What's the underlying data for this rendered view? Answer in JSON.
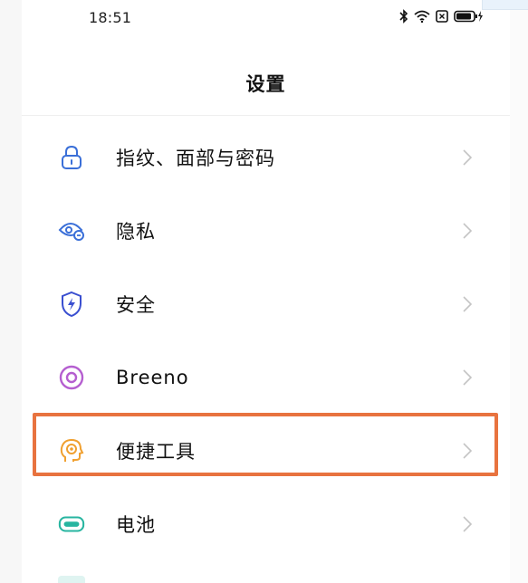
{
  "status_bar": {
    "time": "18:51",
    "icons": [
      "bluetooth-icon",
      "wifi-icon",
      "sim-off-icon",
      "battery-charging-icon"
    ]
  },
  "header": {
    "title": "设置"
  },
  "settings": {
    "items": [
      {
        "label": "指纹、面部与密码",
        "icon": "lock-icon",
        "color": "#3a6fd8"
      },
      {
        "label": "隐私",
        "icon": "privacy-eye-icon",
        "color": "#3a6fd8"
      },
      {
        "label": "安全",
        "icon": "shield-bolt-icon",
        "color": "#3a4fd0"
      },
      {
        "label": "Breeno",
        "icon": "breeno-ring-icon",
        "color": "#b55fd0"
      },
      {
        "label": "便捷工具",
        "icon": "head-gear-icon",
        "color": "#f0a030"
      },
      {
        "label": "电池",
        "icon": "battery-icon",
        "color": "#27b5a0"
      }
    ]
  },
  "highlight": {
    "color": "#e8733f",
    "target": "便捷工具"
  }
}
